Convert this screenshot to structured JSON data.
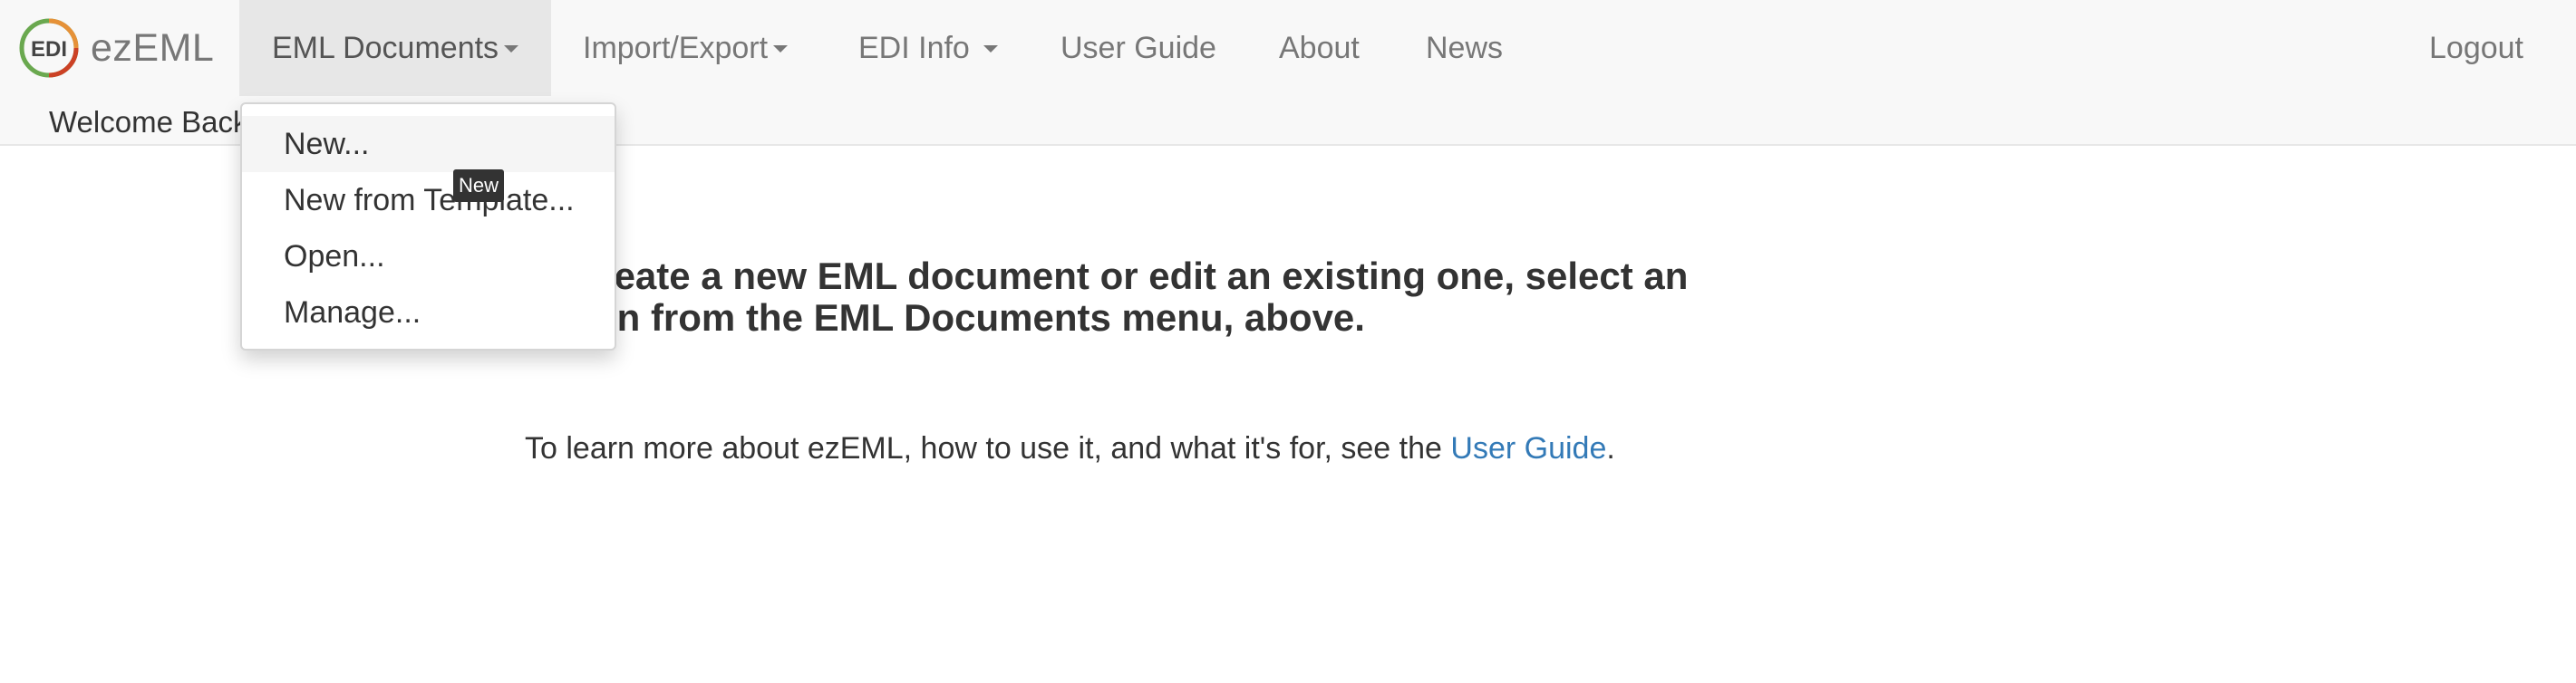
{
  "brand": {
    "name": "ezEML",
    "logo_letters": "EDI",
    "icon": "edi-logo-icon"
  },
  "nav": {
    "items": [
      {
        "label": "EML Documents",
        "has_caret": true,
        "active": true
      },
      {
        "label": "Import/Export",
        "has_caret": true
      },
      {
        "label": "EDI Info",
        "has_caret": true
      },
      {
        "label": "User Guide"
      },
      {
        "label": "About"
      },
      {
        "label": "News"
      }
    ],
    "logout_label": "Logout"
  },
  "welcome_text": "Welcome Back",
  "dropdown": {
    "items": [
      "New...",
      "New from Template...",
      "Open...",
      "Manage..."
    ],
    "hovered_index": 0
  },
  "tooltip": "New",
  "main": {
    "intro_line1": "To create a new EML document or edit an existing one, select an",
    "intro_line2": "option from the EML Documents menu, above.",
    "learn_prefix": "To learn more about ezEML, how to use it, and what it's for, see the ",
    "learn_link": "User Guide",
    "learn_suffix": "."
  },
  "colors": {
    "navbar_bg": "#f8f8f8",
    "active_nav_bg": "#e7e7e7",
    "link": "#337ab7",
    "tooltip_bg": "#333333"
  }
}
